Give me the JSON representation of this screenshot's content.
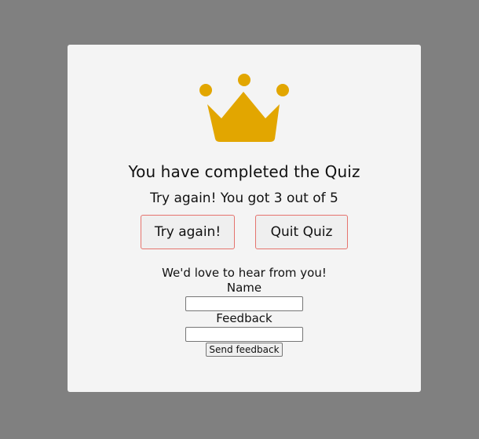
{
  "colors": {
    "backdrop": "#808080",
    "card": "#f4f4f4",
    "crown": "#e2a600",
    "button_border": "#e5736d"
  },
  "result": {
    "icon": "crown-icon",
    "title": "You have completed the Quiz",
    "score_prefix": "Try again! You got",
    "score_value": "3",
    "score_middle": "out of",
    "score_total": "5"
  },
  "actions": {
    "retry_label": "Try again!",
    "quit_label": "Quit Quiz"
  },
  "feedback": {
    "heading": "We'd love to hear from you!",
    "name_label": "Name",
    "name_value": "",
    "feedback_label": "Feedback",
    "feedback_value": "",
    "send_label": "Send feedback"
  }
}
